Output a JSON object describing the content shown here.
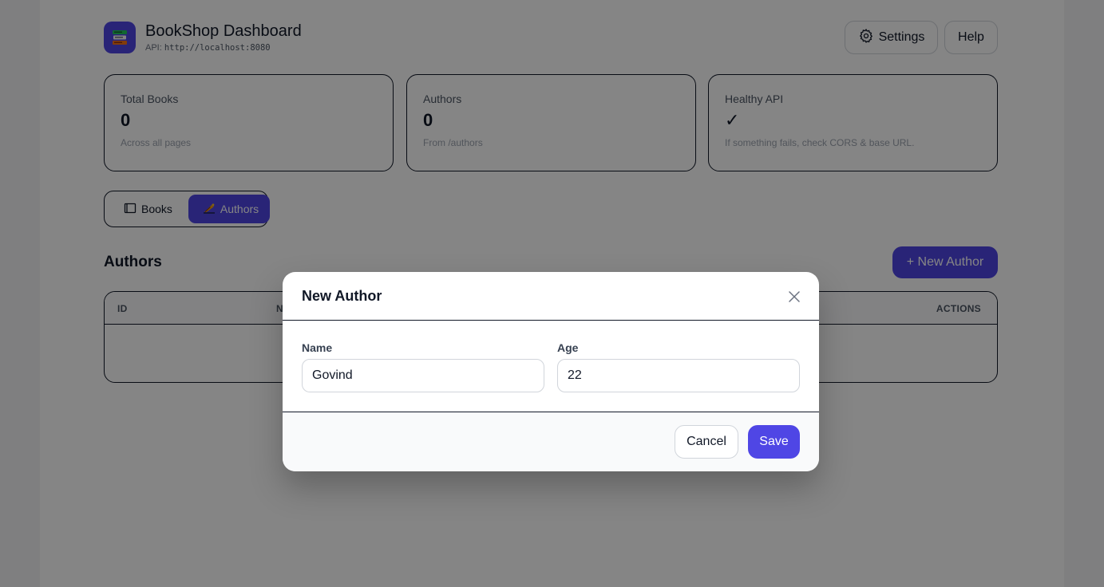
{
  "header": {
    "title": "BookShop Dashboard",
    "api_label": "API:",
    "api_url": "http://localhost:8080",
    "settings_label": "Settings",
    "help_label": "Help"
  },
  "stats": [
    {
      "label": "Total Books",
      "value": "0",
      "sub": "Across all pages"
    },
    {
      "label": "Authors",
      "value": "0",
      "sub": "From /authors"
    },
    {
      "label": "Healthy API",
      "value": "✓",
      "sub": "If something fails, check CORS & base URL."
    }
  ],
  "tabs": [
    {
      "label": "Books",
      "icon": "book-icon",
      "active": false
    },
    {
      "label": "Authors",
      "icon": "quill-icon",
      "active": true
    }
  ],
  "section": {
    "title": "Authors",
    "new_button": "+ New Author"
  },
  "table": {
    "columns": [
      "ID",
      "N",
      "ACTIONS"
    ]
  },
  "modal": {
    "title": "New Author",
    "name_label": "Name",
    "name_value": "Govind",
    "age_label": "Age",
    "age_value": "22",
    "cancel_label": "Cancel",
    "save_label": "Save"
  },
  "colors": {
    "accent": "#4f46e5",
    "overlay": "rgba(0,0,0,0.48)"
  }
}
